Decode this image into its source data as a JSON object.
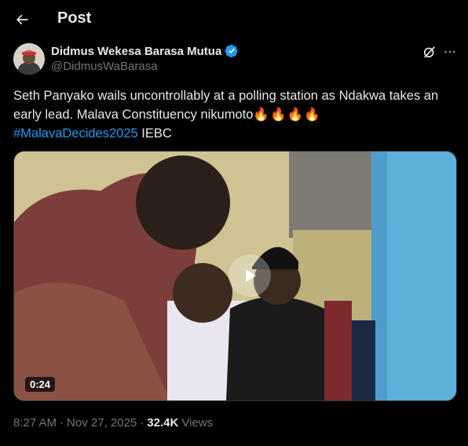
{
  "header": {
    "title": "Post"
  },
  "author": {
    "display_name": "Didmus Wekesa Barasa Mutua",
    "handle": "@DidmusWaBarasa"
  },
  "tweet": {
    "line1": "Seth Panyako wails uncontrollably at a polling station as Ndakwa takes an early lead. Malava Constituency nikumoto",
    "emojis": "🔥🔥🔥🔥",
    "hashtag": "#MalavaDecides2025",
    "trailing": " IEBC"
  },
  "media": {
    "duration": "0:24"
  },
  "meta": {
    "time": "8:27 AM",
    "dot1": "·",
    "date": "Nov 27, 2025",
    "dot2": "·",
    "views_count": "32.4K",
    "views_label": "Views"
  },
  "icons": {
    "back": "arrow-left-icon",
    "verified": "verified-badge-icon",
    "grok": "grok-icon",
    "more": "more-horizontal-icon",
    "play": "play-icon"
  },
  "colors": {
    "accent": "#1d9bf0",
    "background": "#000000",
    "text": "#e7e9ea",
    "muted": "#71767b"
  }
}
